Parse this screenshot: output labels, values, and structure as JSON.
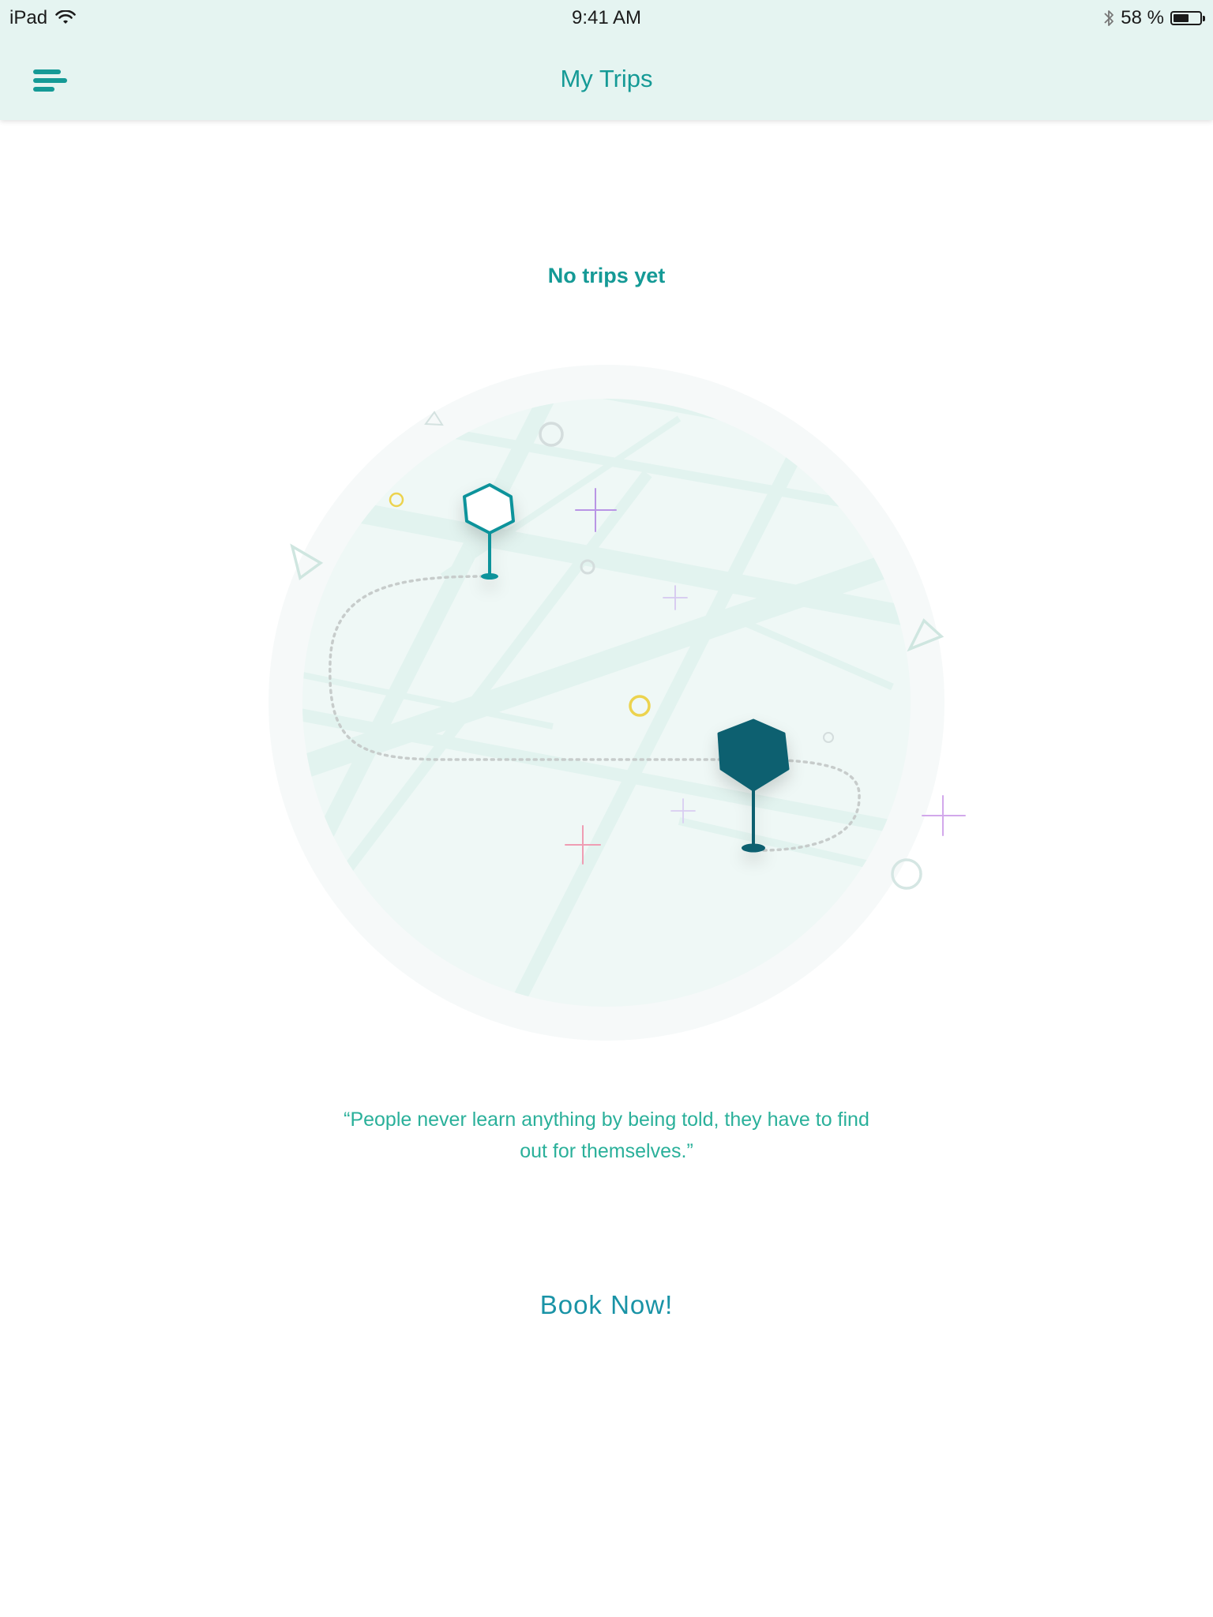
{
  "status_bar": {
    "device": "iPad",
    "time": "9:41 AM",
    "battery_text": "58 %",
    "battery_level": 0.58,
    "icons": [
      "wifi-icon",
      "bluetooth-icon",
      "battery-icon"
    ]
  },
  "nav": {
    "menu_icon": "menu-icon",
    "title": "My Trips"
  },
  "empty_state": {
    "title": "No trips yet",
    "illustration": "map-route-illustration",
    "quote": "“People never learn anything by being told, they have to find out for themselves.”",
    "cta_label": "Book Now!"
  },
  "colors": {
    "primary_teal": "#159a96",
    "dark_pin": "#0b6070",
    "header_bg": "#e5f4f1",
    "quote_text": "#2ab09a",
    "cta_text": "#1993a6"
  }
}
